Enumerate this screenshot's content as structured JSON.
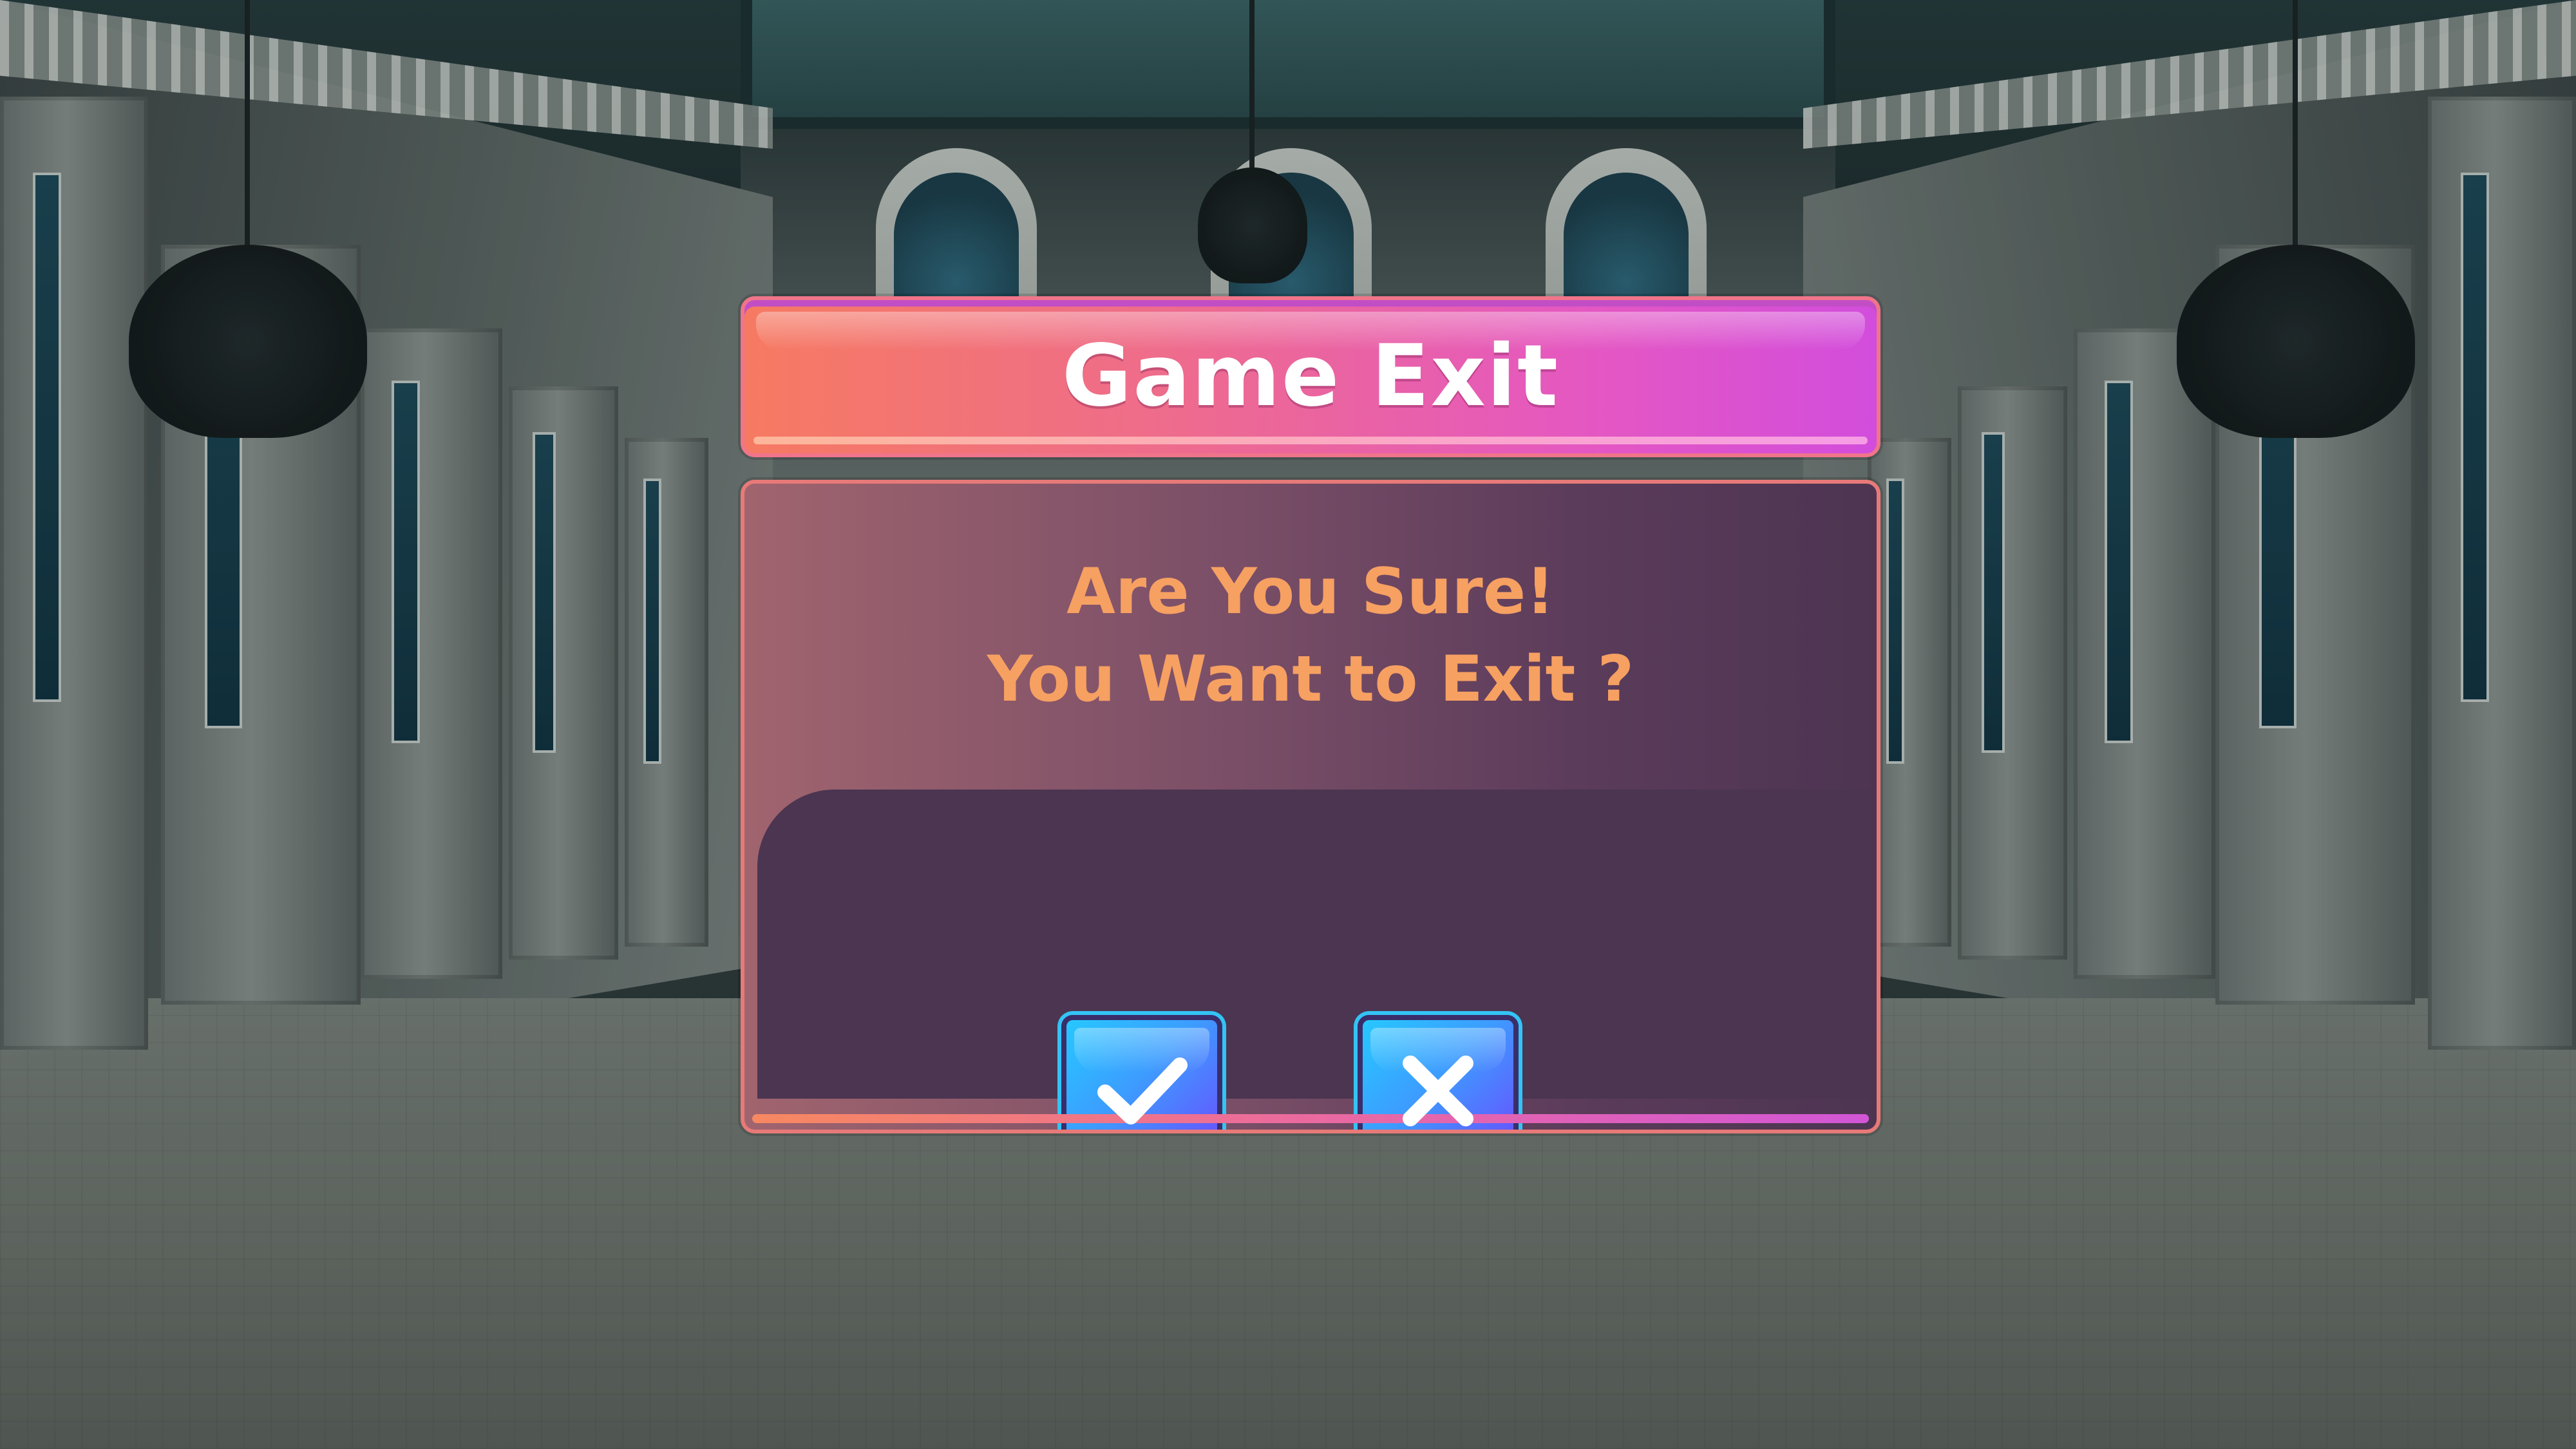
{
  "dialog": {
    "title": "Game Exit",
    "message_line1": "Are You Sure!",
    "message_line2": "You Want to Exit ?",
    "confirm_icon": "checkmark-icon",
    "cancel_icon": "close-icon"
  },
  "colors": {
    "title_gradient_start": "#f67a62",
    "title_gradient_end": "#d24ddc",
    "title_text": "#ffffff",
    "message_text": "#f6a062",
    "panel_dark": "#4b3551",
    "button_gradient_start": "#26c8ff",
    "button_gradient_end": "#6c49ff"
  }
}
